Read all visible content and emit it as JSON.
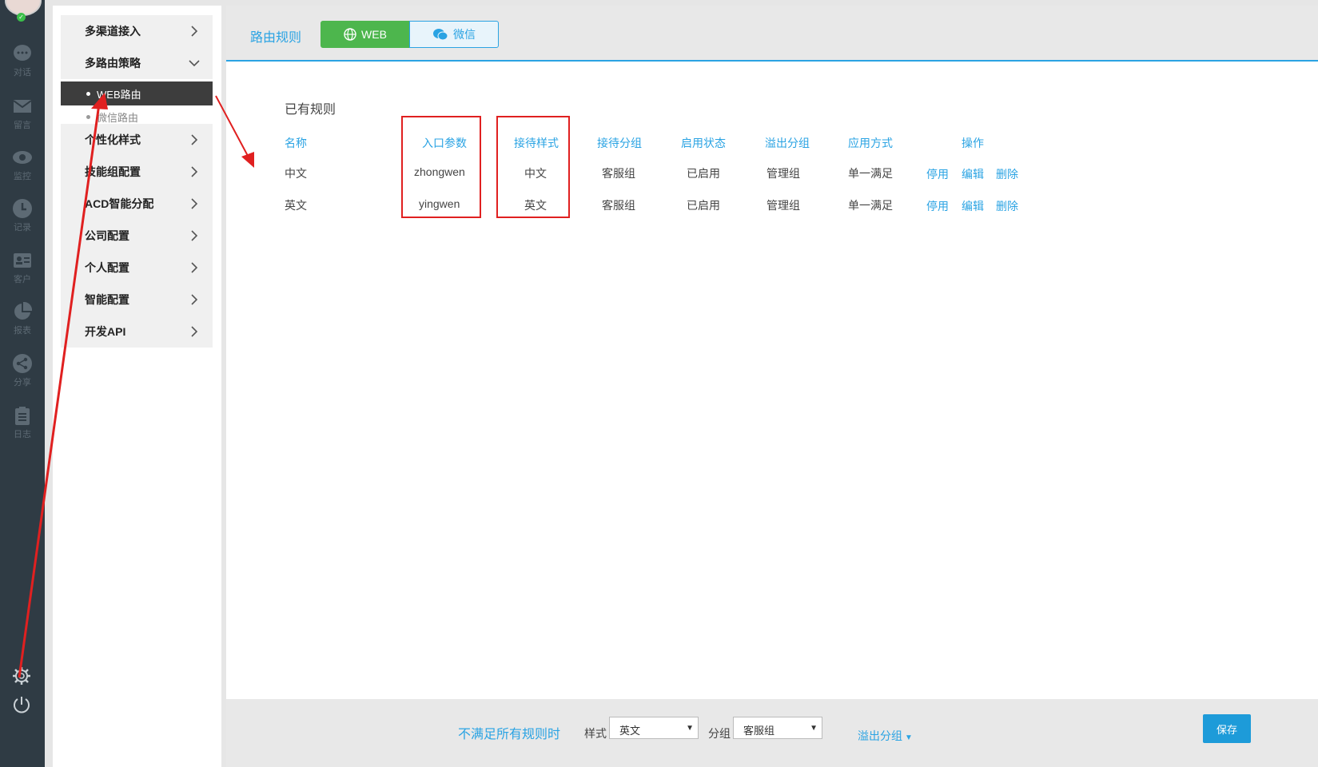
{
  "rail": {
    "items": [
      {
        "label": "对话",
        "icon": "chat-bubble-icon"
      },
      {
        "label": "留言",
        "icon": "envelope-icon"
      },
      {
        "label": "监控",
        "icon": "eye-icon"
      },
      {
        "label": "记录",
        "icon": "clock-icon"
      },
      {
        "label": "客户",
        "icon": "contact-card-icon"
      },
      {
        "label": "报表",
        "icon": "pie-chart-icon"
      },
      {
        "label": "分享",
        "icon": "share-icon"
      },
      {
        "label": "日志",
        "icon": "clipboard-icon"
      }
    ],
    "bottom": [
      {
        "icon": "gear-icon"
      },
      {
        "icon": "power-icon"
      }
    ],
    "status": "online"
  },
  "submenu": {
    "items": [
      {
        "label": "多渠道接入",
        "state": "collapsed"
      },
      {
        "label": "多路由策略",
        "state": "expanded"
      },
      {
        "label": "个性化样式",
        "state": "collapsed"
      },
      {
        "label": "技能组配置",
        "state": "collapsed"
      },
      {
        "label": "ACD智能分配",
        "state": "collapsed"
      },
      {
        "label": "公司配置",
        "state": "collapsed"
      },
      {
        "label": "个人配置",
        "state": "collapsed"
      },
      {
        "label": "智能配置",
        "state": "collapsed"
      },
      {
        "label": "开发API",
        "state": "collapsed"
      }
    ],
    "children": [
      {
        "label": "WEB路由",
        "active": true
      },
      {
        "label": "微信路由",
        "active": false
      }
    ]
  },
  "header": {
    "title": "路由规则",
    "tabs": [
      {
        "label": "WEB",
        "icon": "globe-icon",
        "active": true
      },
      {
        "label": "微信",
        "icon": "wechat-icon",
        "active": false
      }
    ]
  },
  "rules": {
    "title": "已有规则",
    "columns": [
      "名称",
      "入口参数",
      "接待样式",
      "接待分组",
      "启用状态",
      "溢出分组",
      "应用方式",
      "操作"
    ],
    "rows": [
      {
        "name": "中文",
        "param": "zhongwen",
        "style": "中文",
        "group": "客服组",
        "status": "已启用",
        "overflow": "管理组",
        "mode": "单一满足",
        "actions": [
          "停用",
          "编辑",
          "删除"
        ]
      },
      {
        "name": "英文",
        "param": "yingwen",
        "style": "英文",
        "group": "客服组",
        "status": "已启用",
        "overflow": "管理组",
        "mode": "单一满足",
        "actions": [
          "停用",
          "编辑",
          "删除"
        ]
      }
    ]
  },
  "footer": {
    "fallback_label": "不满足所有规则时",
    "style_label": "样式",
    "style_value": "英文",
    "group_label": "分组",
    "group_value": "客服组",
    "overflow_link": "溢出分组",
    "save_label": "保存"
  },
  "colors": {
    "accent": "#2aa3e3",
    "active_tab": "#4db64d",
    "annotation": "#e02020",
    "rail": "#2f3b44"
  }
}
